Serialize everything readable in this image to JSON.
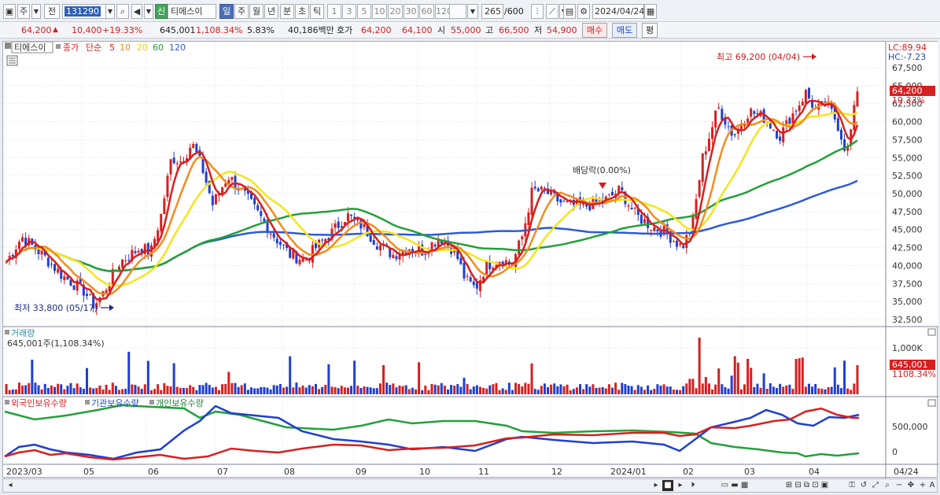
{
  "toolbar": {
    "period_label": "주",
    "prev_label": "전",
    "code_value": "131290",
    "badge_label": "신",
    "stock_name": "티에스이",
    "tf_day": "일",
    "tf_week": "주",
    "tf_month": "월",
    "tf_year": "년",
    "tf_minute": "분",
    "tf_second": "초",
    "tf_tick": "틱",
    "intervals": [
      "1",
      "3",
      "5",
      "10",
      "20",
      "30",
      "60",
      "120"
    ],
    "count_display": "265",
    "count_max": "/600",
    "date_value": "2024/04/24"
  },
  "quote": {
    "price": "64,200",
    "change": "10,400",
    "change_pct": "+19.33%",
    "volume": "645,001",
    "volume_pct": "1,108.34%",
    "turnover": "5.83%",
    "amount": "40,186백만",
    "ask_label": "호가",
    "ask1": "64,200",
    "ask2": "64,100",
    "open_label": "시",
    "open": "55,000",
    "high_label": "고",
    "high": "66,500",
    "low_label": "저",
    "low": "54,900",
    "buy_label": "매수",
    "sell_label": "매도",
    "avg_label": "평"
  },
  "price_panel": {
    "stock_tag": "티에스이",
    "legend": {
      "close": "종가",
      "simple": "단순",
      "ma5": "5",
      "ma10": "10",
      "ma20": "20",
      "ma60": "60",
      "ma120": "120"
    },
    "lc": "LC:89.94",
    "hc": "HC:-7.23",
    "last_price": "64,200",
    "last_pct": "19.33%",
    "high_annot": "최고 69,200 (04/04)",
    "low_annot": "최저 33,800 (05/17)",
    "div_annot": "배당락(0.00%)",
    "yticks": [
      "67,500",
      "65,000",
      "62,500",
      "60,000",
      "57,500",
      "55,000",
      "52,500",
      "50,000",
      "47,500",
      "45,000",
      "42,500",
      "40,000",
      "37,500",
      "35,000",
      "32,500"
    ]
  },
  "volume_panel": {
    "title": "거래량",
    "summary": "645,001주(1,108.34%)",
    "ytick": "1,000K",
    "last_value": "645,001",
    "last_pct": "1108.34%"
  },
  "holding_panel": {
    "foreign": "외국인보유수량",
    "institution": "기관보유수량",
    "individual": "개인보유수량",
    "yticks": [
      "500,000",
      "0"
    ]
  },
  "xaxis": {
    "labels": [
      "2023/03",
      "05",
      "06",
      "07",
      "08",
      "09",
      "10",
      "11",
      "12",
      "2024/01",
      "02",
      "03",
      "04"
    ],
    "last_date": "04/24"
  },
  "colors": {
    "up": "#d81f1f",
    "down": "#1f3fd1",
    "ma5": "#d81f1f",
    "ma10": "#f28c1e",
    "ma20": "#f5e51b",
    "ma60": "#23a03a",
    "ma120": "#2c5ad9"
  }
}
